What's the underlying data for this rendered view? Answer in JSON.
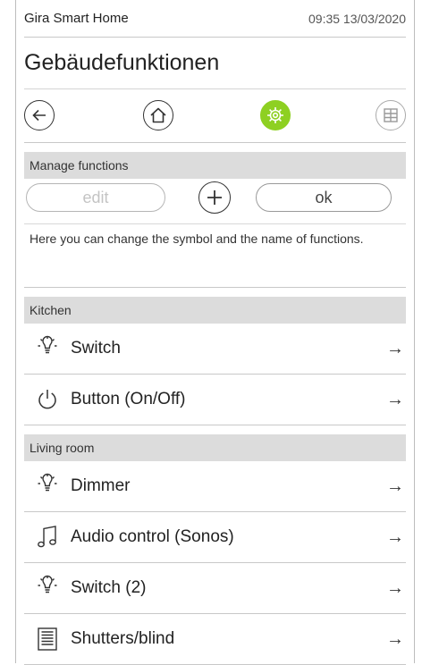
{
  "statusbar": {
    "app_name": "Gira Smart Home",
    "datetime": "09:35 13/03/2020"
  },
  "page": {
    "title": "Gebäudefunktionen"
  },
  "navbar": {
    "icons": [
      "back-arrow-icon",
      "home-icon",
      "settings-gear-icon",
      "grid-icon"
    ],
    "active_color": "#8ed022"
  },
  "manage": {
    "header": "Manage functions",
    "edit_label": "edit",
    "ok_label": "ok",
    "description": "Here you can change the symbol and the name of functions."
  },
  "rooms": [
    {
      "name": "Kitchen",
      "functions": [
        {
          "label": "Switch",
          "icon": "light-bulb-icon",
          "arrow": "→"
        },
        {
          "label": "Button (On/Off)",
          "icon": "power-icon",
          "arrow": "→"
        }
      ]
    },
    {
      "name": "Living room",
      "functions": [
        {
          "label": "Dimmer",
          "icon": "light-bulb-icon",
          "arrow": "→"
        },
        {
          "label": "Audio control (Sonos)",
          "icon": "music-note-icon",
          "arrow": "→"
        },
        {
          "label": "Switch (2)",
          "icon": "light-bulb-icon",
          "arrow": "→"
        },
        {
          "label": "Shutters/blind",
          "icon": "shutter-icon",
          "arrow": "→"
        }
      ]
    }
  ]
}
